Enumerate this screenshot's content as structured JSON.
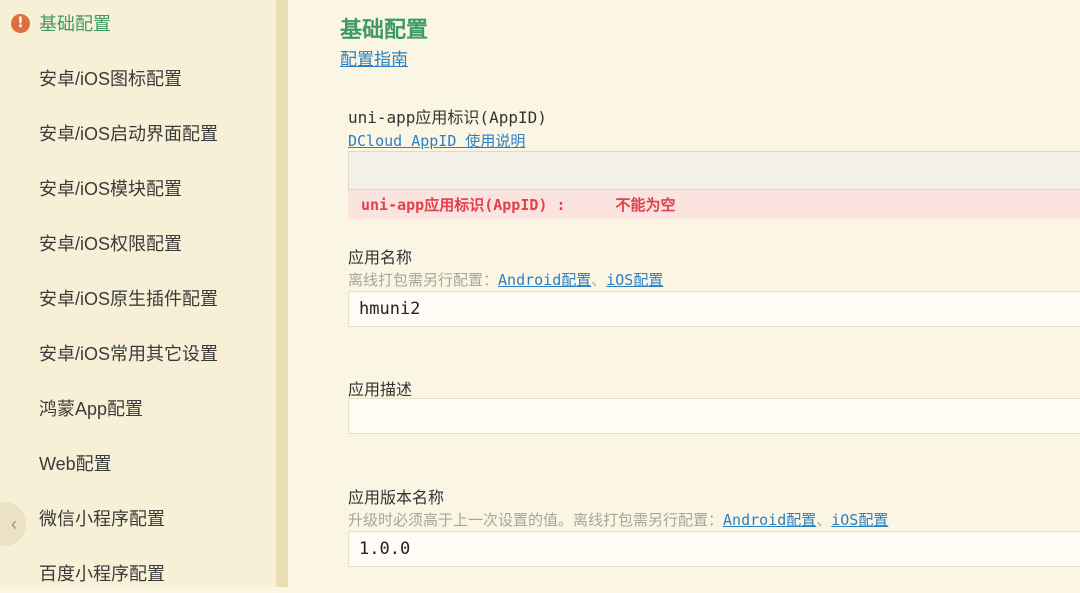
{
  "sidebar": {
    "items": [
      {
        "label": "基础配置",
        "active": true,
        "icon": "warning-icon"
      },
      {
        "label": "安卓/iOS图标配置"
      },
      {
        "label": "安卓/iOS启动界面配置"
      },
      {
        "label": "安卓/iOS模块配置"
      },
      {
        "label": "安卓/iOS权限配置"
      },
      {
        "label": "安卓/iOS原生插件配置"
      },
      {
        "label": "安卓/iOS常用其它设置"
      },
      {
        "label": "鸿蒙App配置"
      },
      {
        "label": "Web配置"
      },
      {
        "label": "微信小程序配置"
      },
      {
        "label": "百度小程序配置"
      }
    ],
    "collapse_icon": "chevron-left-icon"
  },
  "main": {
    "title": "基础配置",
    "guide_link": "配置指南",
    "appid": {
      "label": "uni-app应用标识(AppID)",
      "help_link": "DCloud AppID 使用说明",
      "value": "",
      "error_field": "uni-app应用标识(AppID) :",
      "error_message": "不能为空"
    },
    "app_name": {
      "label": "应用名称",
      "hint": "离线打包需另行配置：",
      "android_link": "Android配置",
      "separator": "、",
      "ios_link": "iOS配置",
      "value": "hmuni2"
    },
    "app_desc": {
      "label": "应用描述",
      "value": ""
    },
    "version_name": {
      "label": "应用版本名称",
      "hint": "升级时必须高于上一次设置的值。离线打包需另行配置：",
      "android_link": "Android配置",
      "separator": "、",
      "ios_link": "iOS配置",
      "value": "1.0.0"
    }
  },
  "colors": {
    "accent_green": "#3f9b61",
    "link_blue": "#2b7fc2",
    "error_red": "#e0414a",
    "warning_orange": "#d9703e"
  }
}
